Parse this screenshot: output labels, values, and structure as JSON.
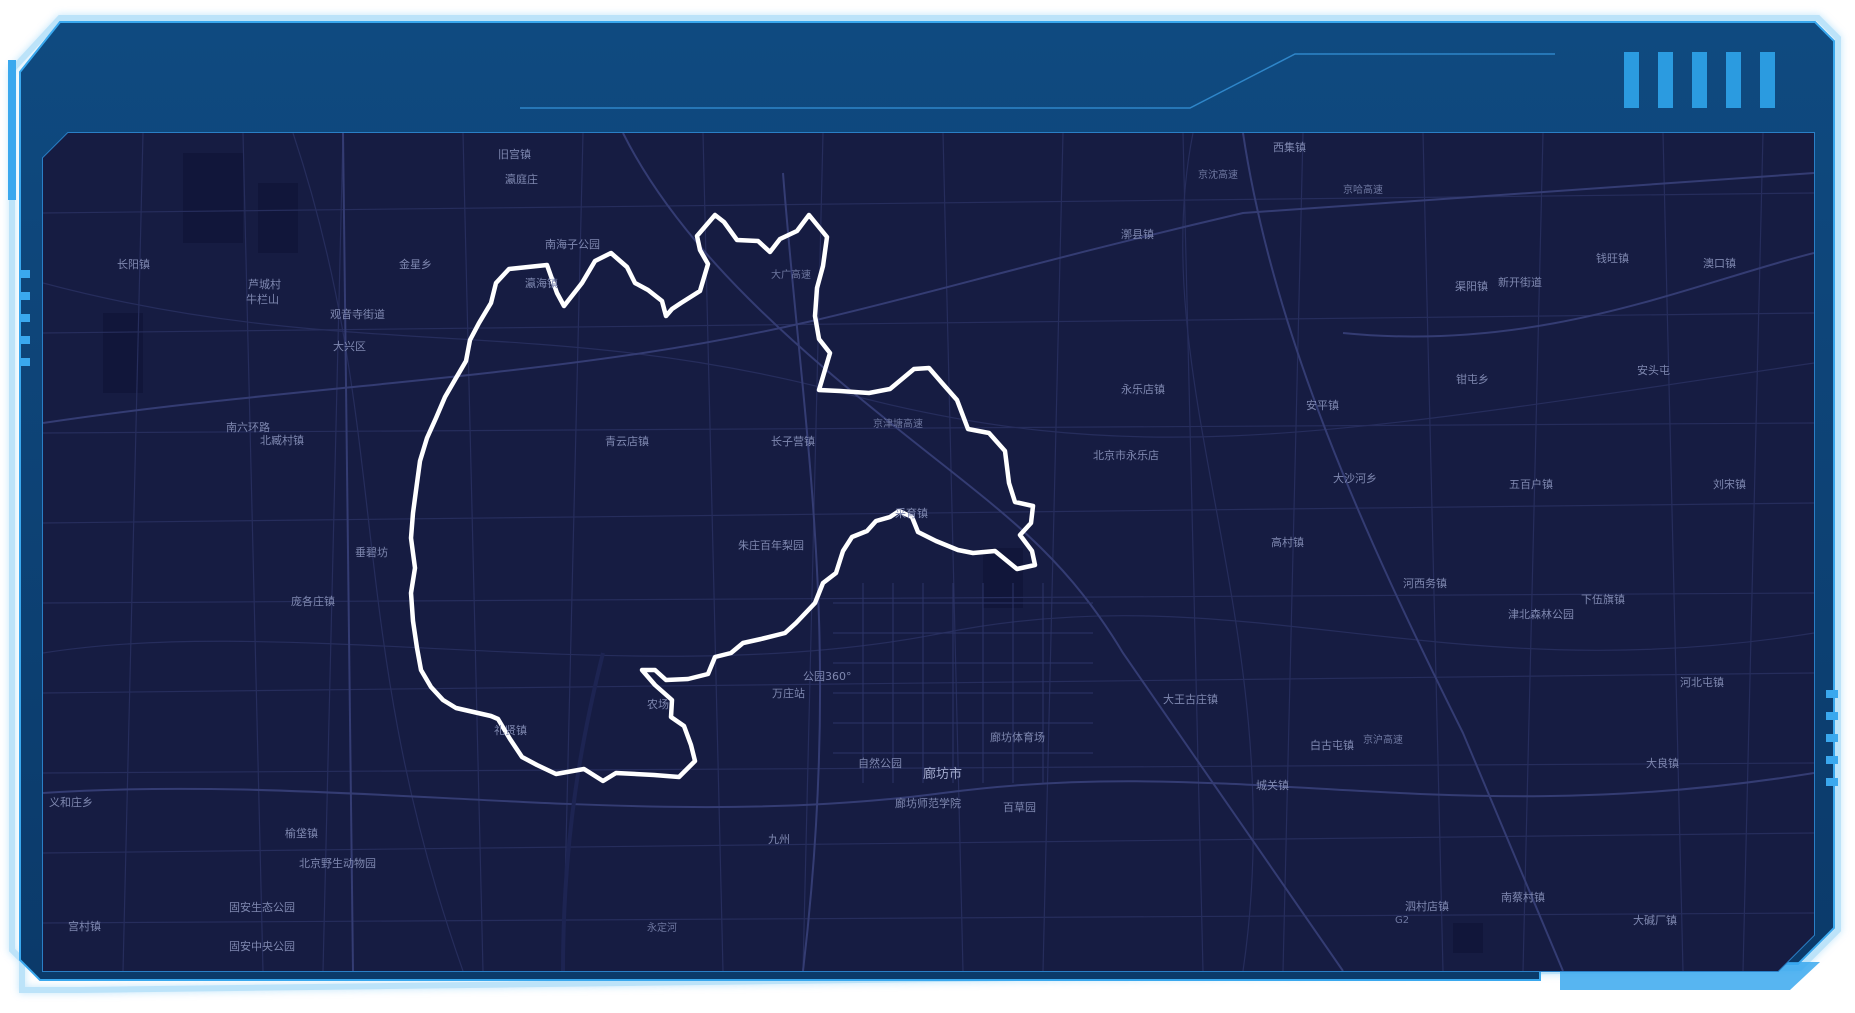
{
  "colors": {
    "frame_dark": "#0b3a6a",
    "frame_mid": "#145a94",
    "frame_glow": "#3aa8ee",
    "accent_bars": "#2b9be0",
    "map_bg": "#161c42",
    "boundary": "#ffffff"
  },
  "header": {
    "title": "",
    "indicator_bar_count": 5
  },
  "map": {
    "region_name": "廊坊市",
    "highlighted_boundary": "white-outline",
    "places": [
      {
        "name": "旧宫镇"
      },
      {
        "name": "瀛庭庄"
      },
      {
        "name": "南海子公园"
      },
      {
        "name": "瀛海镇"
      },
      {
        "name": "长阳镇"
      },
      {
        "name": "芦城村"
      },
      {
        "name": "牛栏山"
      },
      {
        "name": "金星乡"
      },
      {
        "name": "观音寺街道"
      },
      {
        "name": "大兴区"
      },
      {
        "name": "南六环路"
      },
      {
        "name": "北臧村镇"
      },
      {
        "name": "青云店镇"
      },
      {
        "name": "长子营镇"
      },
      {
        "name": "采育镇"
      },
      {
        "name": "朱庄百年梨园"
      },
      {
        "name": "垂碧坊"
      },
      {
        "name": "庞各庄镇"
      },
      {
        "name": "礼贤镇"
      },
      {
        "name": "农场"
      },
      {
        "name": "万庄站"
      },
      {
        "name": "公园360°"
      },
      {
        "name": "自然公园"
      },
      {
        "name": "廊坊市"
      },
      {
        "name": "廊坊体育场"
      },
      {
        "name": "廊坊师范学院"
      },
      {
        "name": "百草园"
      },
      {
        "name": "九州"
      },
      {
        "name": "榆垡镇"
      },
      {
        "name": "北京野生动物园"
      },
      {
        "name": "固安生态公园"
      },
      {
        "name": "固安中央公园"
      },
      {
        "name": "宫村镇"
      },
      {
        "name": "义和庄乡"
      },
      {
        "name": "西集镇"
      },
      {
        "name": "京沈高速"
      },
      {
        "name": "京哈高速"
      },
      {
        "name": "漷县镇"
      },
      {
        "name": "永乐店镇"
      },
      {
        "name": "北京市永乐店"
      },
      {
        "name": "安平镇"
      },
      {
        "name": "大沙河乡"
      },
      {
        "name": "高村镇"
      },
      {
        "name": "河西务镇"
      },
      {
        "name": "大王古庄镇"
      },
      {
        "name": "白古屯镇"
      },
      {
        "name": "城关镇"
      },
      {
        "name": "泗村店镇"
      },
      {
        "name": "南蔡村镇"
      },
      {
        "name": "大碱厂镇"
      },
      {
        "name": "大良镇"
      },
      {
        "name": "河北屯镇"
      },
      {
        "name": "下伍旗镇"
      },
      {
        "name": "津北森林公园"
      },
      {
        "name": "五百户镇"
      },
      {
        "name": "刘宋镇"
      },
      {
        "name": "钱旺镇"
      },
      {
        "name": "澳口镇"
      },
      {
        "name": "新开街道"
      },
      {
        "name": "渠阳镇"
      },
      {
        "name": "安头屯"
      },
      {
        "name": "钳屯乡"
      },
      {
        "name": "大广高速"
      },
      {
        "name": "京津塘高速"
      },
      {
        "name": "永定河"
      },
      {
        "name": "京沪高速"
      },
      {
        "name": "G2"
      }
    ]
  }
}
